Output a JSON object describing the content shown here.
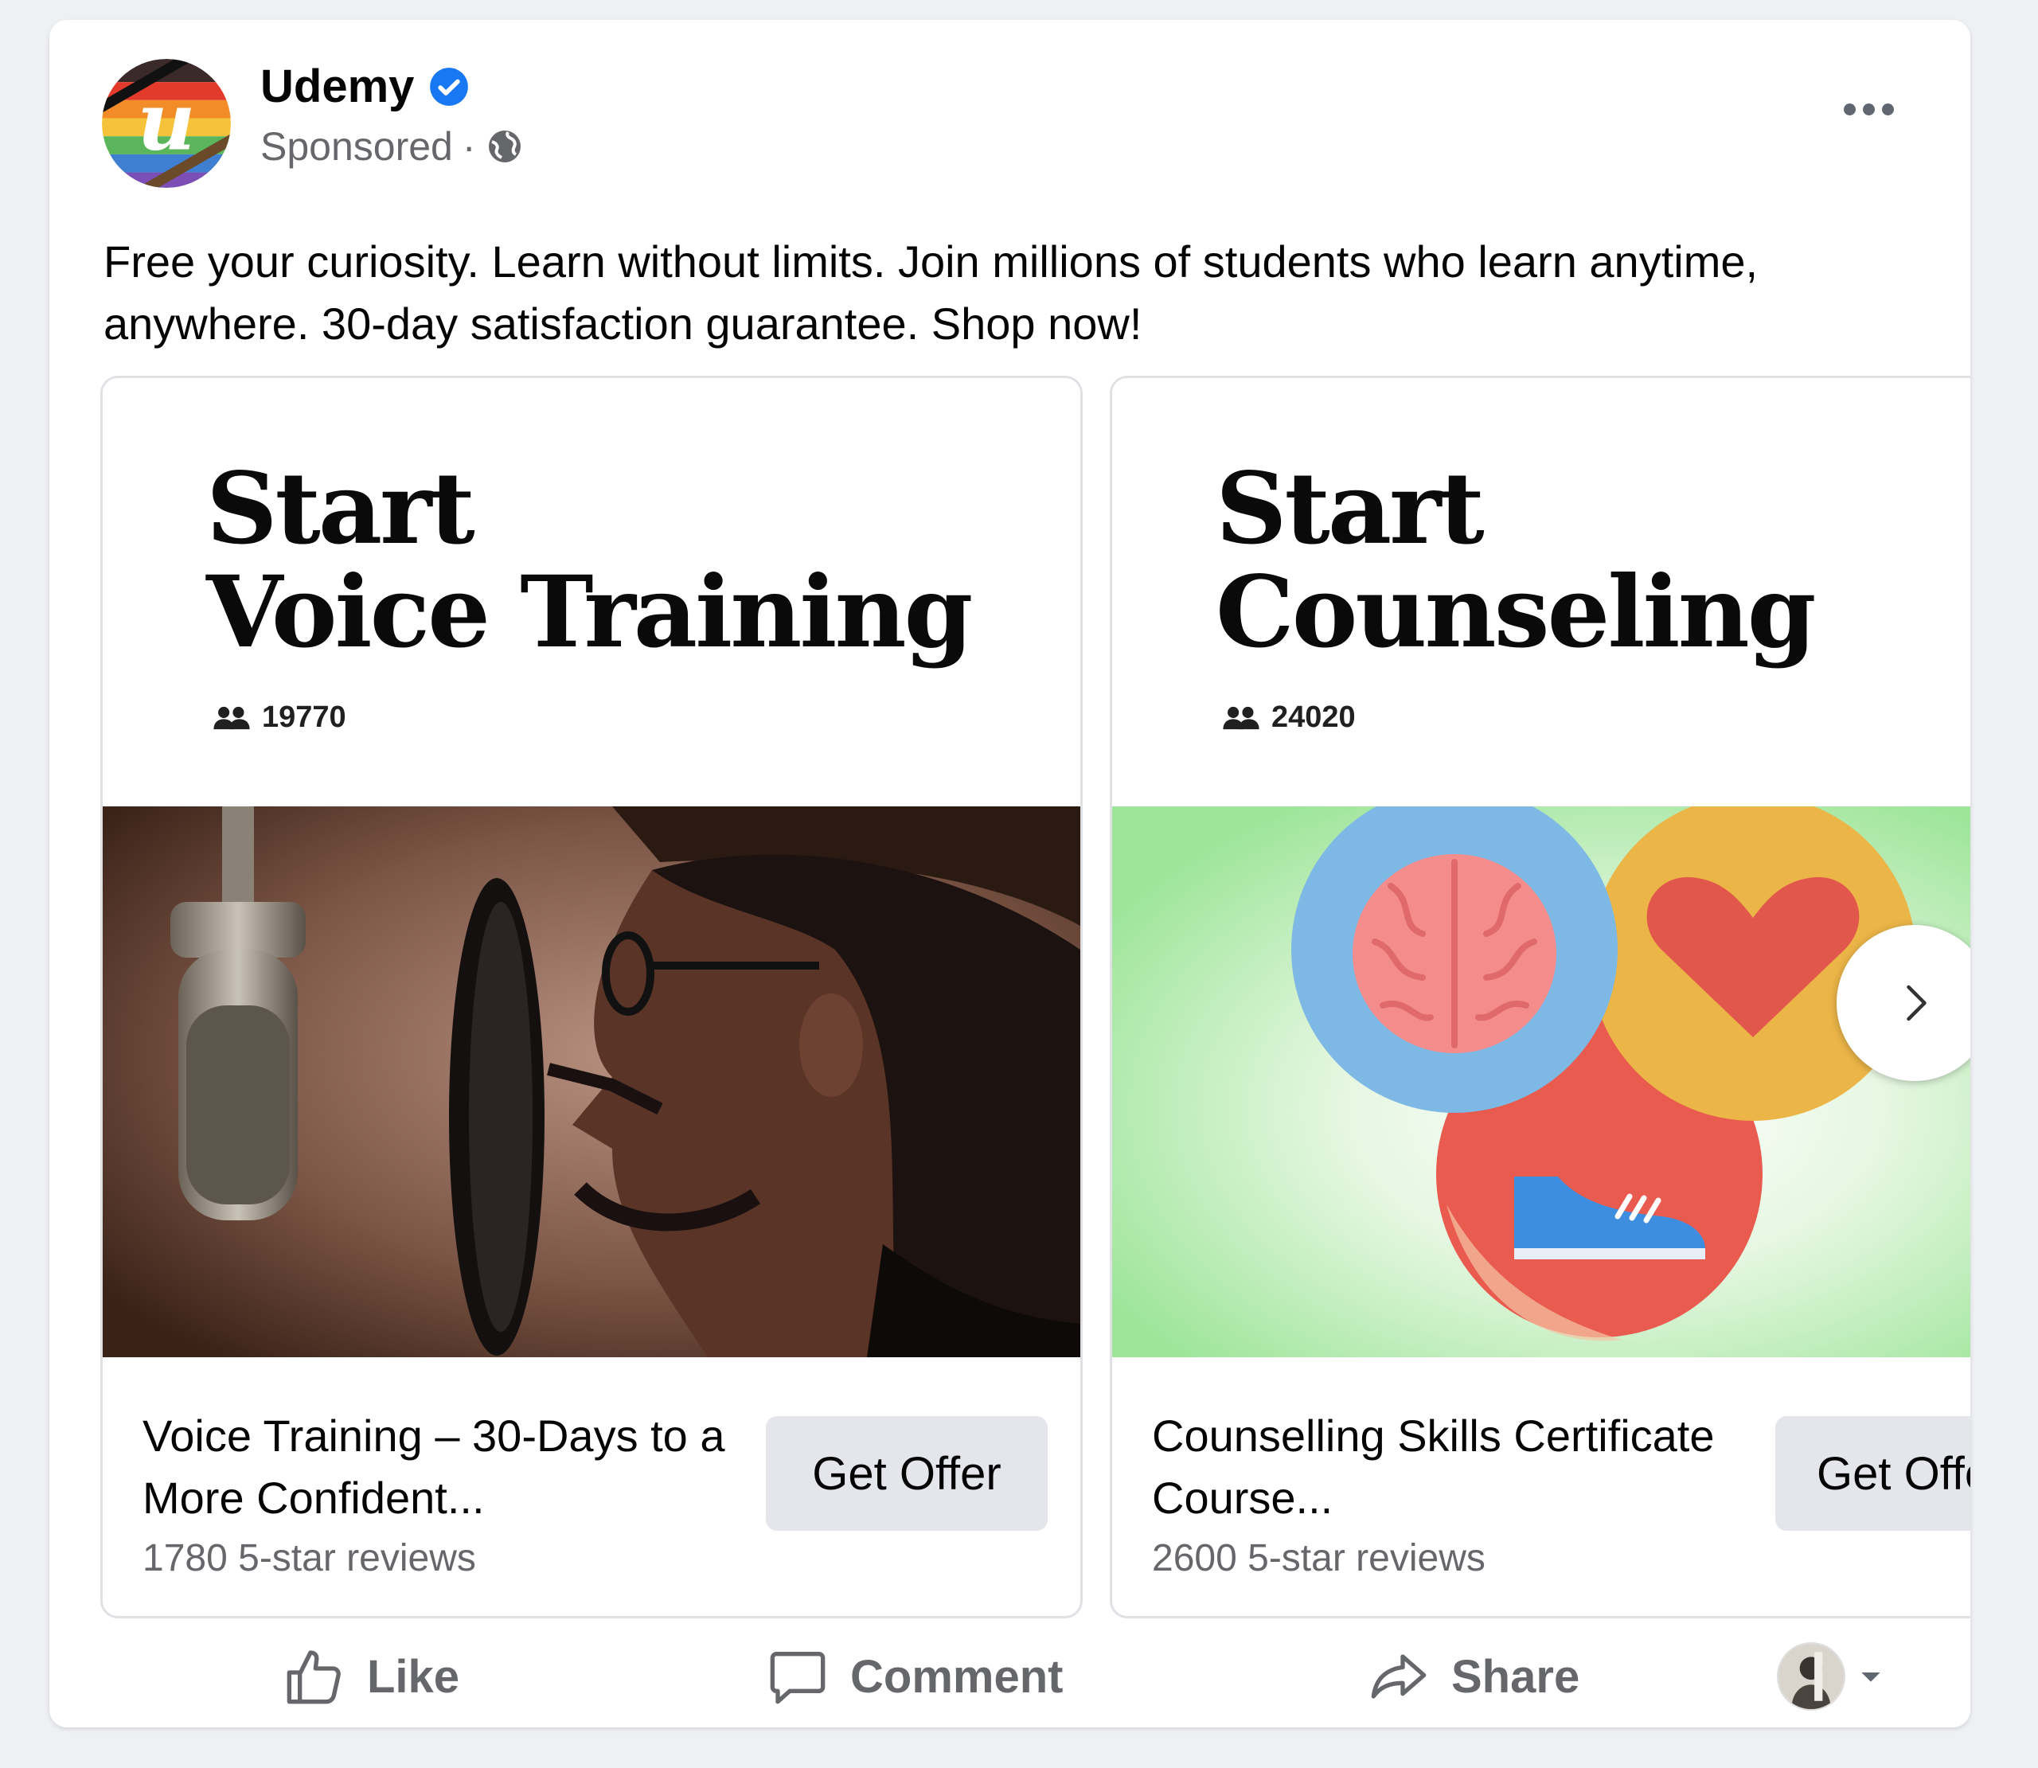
{
  "post": {
    "author": "Udemy",
    "sponsored_label": "Sponsored",
    "separator": " · ",
    "caption": "Free your curiosity. Learn without limits. Join millions of students who learn anytime, anywhere. 30-day satisfaction guarantee. Shop now!"
  },
  "cards": [
    {
      "title_line1": "Start",
      "title_line2": "Voice Training",
      "student_count": "19770",
      "course_title": "Voice Training – 30-Days to a More Confident...",
      "reviews": "1780 5-star reviews",
      "cta": "Get Offer"
    },
    {
      "title_line1": "Start",
      "title_line2": "Counseling",
      "student_count": "24020",
      "course_title": "Counselling Skills Certificate Course...",
      "reviews": "2600 5-star reviews",
      "cta": "Get Offer"
    }
  ],
  "actions": {
    "like": "Like",
    "comment": "Comment",
    "share": "Share"
  },
  "colors": {
    "secondary_text": "#65676b",
    "verified_blue": "#1877f2",
    "button_bg": "#e4e6eb"
  }
}
